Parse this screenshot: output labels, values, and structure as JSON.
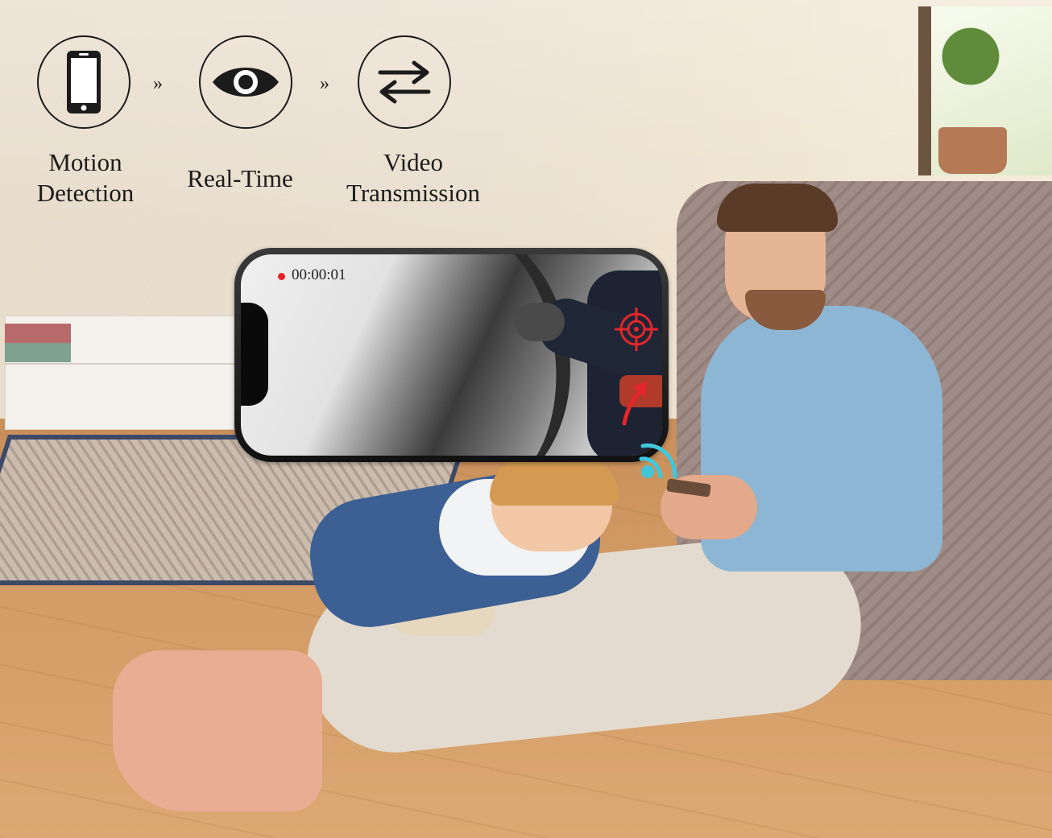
{
  "features": [
    {
      "icon": "smartphone-icon",
      "caption_lines": [
        "Motion",
        "Detection"
      ]
    },
    {
      "icon": "eye-icon",
      "caption_lines": [
        "Real-Time"
      ]
    },
    {
      "icon": "swap-arrows-icon",
      "caption_lines": [
        "Video",
        "Transmission"
      ]
    }
  ],
  "separator": "»",
  "phone_overlay": {
    "recording_time": "00:00:01",
    "indicator_icon": "record-dot-icon",
    "target_icon": "crosshair-target-icon",
    "motion_icon": "curved-arrow-icon"
  },
  "signal_icon": "wifi-signal-icon",
  "colors": {
    "icon_ink": "#1b1b1b",
    "record_red": "#e8232a",
    "alert_red": "#e3262b",
    "signal_cyan": "#3fc7dc"
  }
}
